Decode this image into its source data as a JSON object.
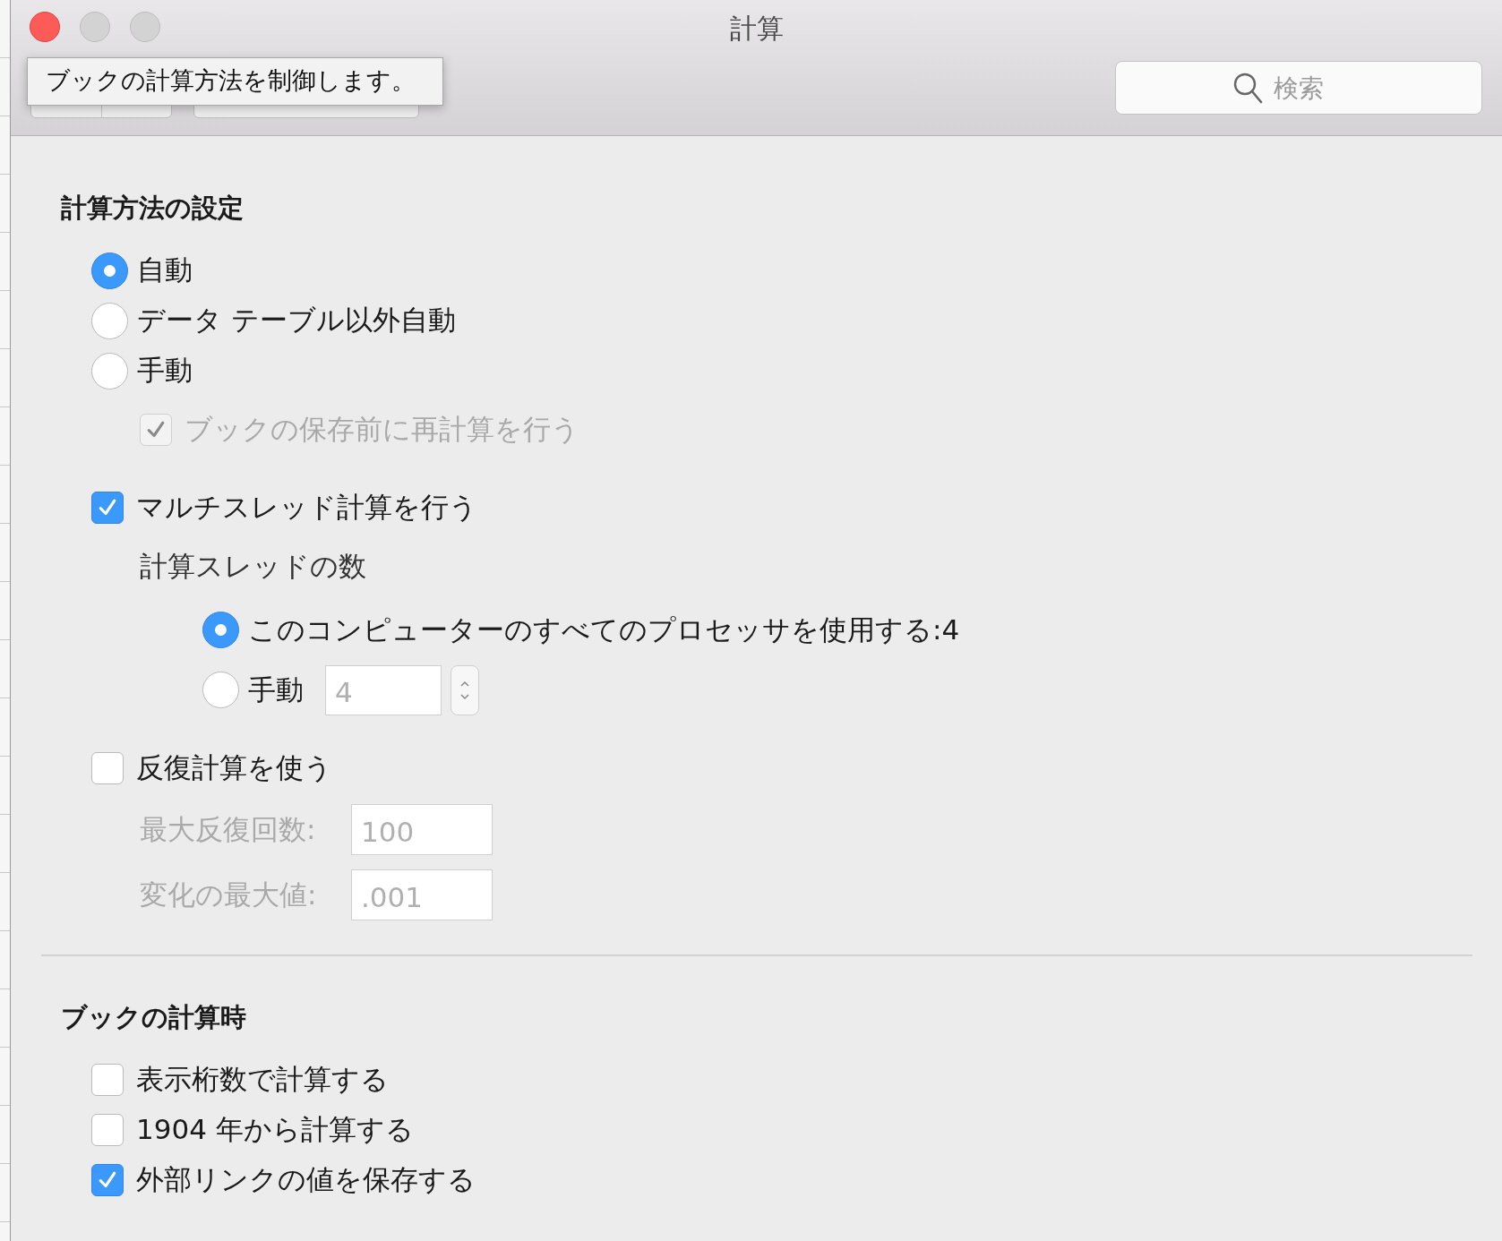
{
  "window": {
    "title": "計算",
    "tooltip": "ブックの計算方法を制御します。",
    "search": {
      "placeholder": "検索"
    }
  },
  "sections": [
    {
      "heading": "計算方法の設定",
      "items": [
        {
          "kind": "radio",
          "label": "自動",
          "selected": true
        },
        {
          "kind": "radio",
          "label": "データ テーブル以外自動",
          "selected": false
        },
        {
          "kind": "radio",
          "label": "手動",
          "selected": false,
          "children": [
            {
              "kind": "checkbox",
              "label": "ブックの保存前に再計算を行う",
              "checked": true,
              "disabled": true
            }
          ]
        },
        {
          "kind": "checkbox",
          "label": "マルチスレッド計算を行う",
          "checked": true,
          "children": [
            {
              "kind": "label",
              "label": "計算スレッドの数",
              "children": [
                {
                  "kind": "radio",
                  "label": "このコンピューターのすべてのプロセッサを使用する:4",
                  "selected": true
                },
                {
                  "kind": "radio-number",
                  "label": "手動",
                  "selected": false,
                  "value": "4",
                  "disabled": true
                }
              ]
            }
          ]
        },
        {
          "kind": "checkbox",
          "label": "反復計算を使う",
          "checked": false,
          "children": [
            {
              "kind": "field",
              "label": "最大反復回数:",
              "value": "100",
              "disabled": true
            },
            {
              "kind": "field",
              "label": "変化の最大値:",
              "value": ".001",
              "disabled": true
            }
          ]
        }
      ]
    },
    {
      "heading": "ブックの計算時",
      "items": [
        {
          "kind": "checkbox",
          "label": "表示桁数で計算する",
          "checked": false
        },
        {
          "kind": "checkbox",
          "label": "1904 年から計算する",
          "checked": false
        },
        {
          "kind": "checkbox",
          "label": "外部リンクの値を保存する",
          "checked": true
        }
      ]
    }
  ]
}
